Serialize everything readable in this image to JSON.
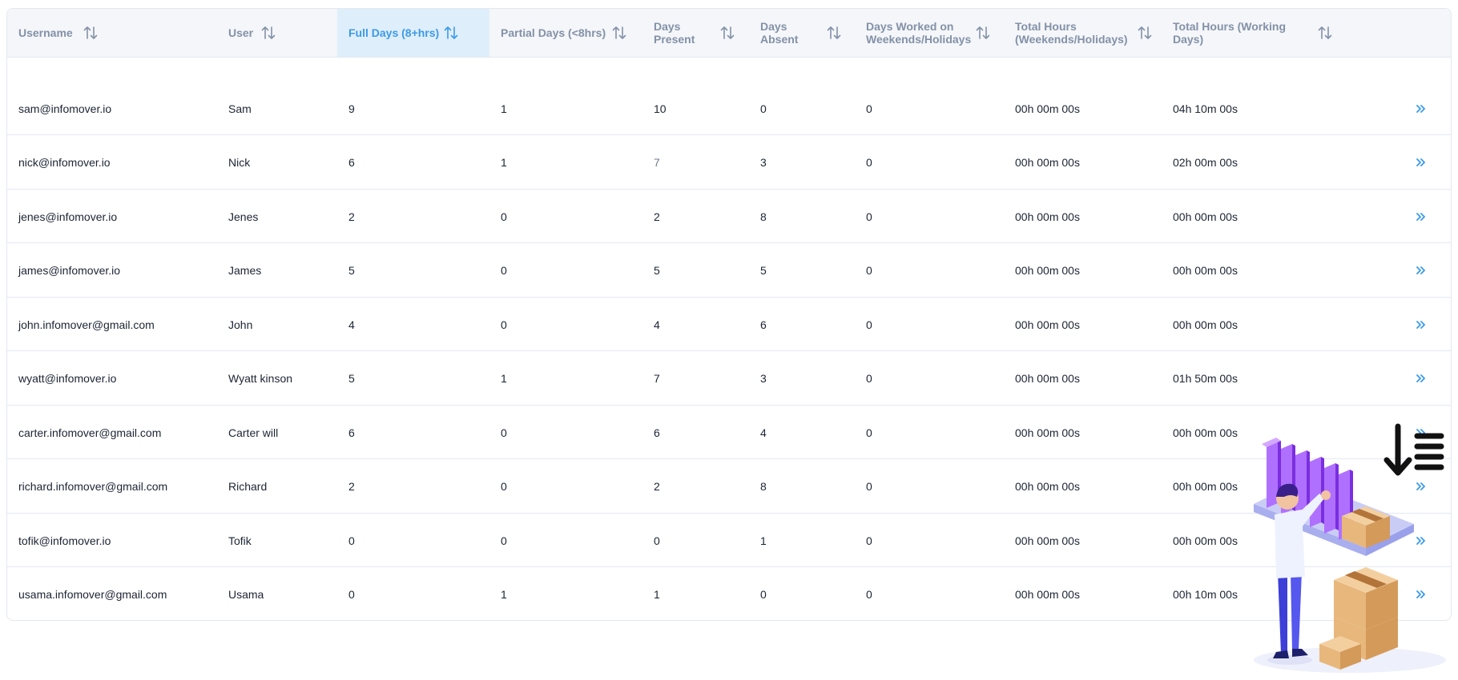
{
  "table": {
    "columns": [
      {
        "key": "username",
        "label": "Username",
        "sort_icon": "sort-arrows-icon",
        "active": false
      },
      {
        "key": "user",
        "label": "User",
        "sort_icon": "sort-arrows-icon",
        "active": false
      },
      {
        "key": "full_days",
        "label": "Full Days (8+hrs)",
        "sort_icon": "sort-arrows-icon",
        "active": true
      },
      {
        "key": "partial_days",
        "label": "Partial Days (<8hrs)",
        "sort_icon": "sort-arrows-icon",
        "active": false
      },
      {
        "key": "days_present",
        "label": "Days\nPresent",
        "sort_icon": "sort-arrows-icon",
        "active": false
      },
      {
        "key": "days_absent",
        "label": "Days\nAbsent",
        "sort_icon": "sort-arrows-icon",
        "active": false
      },
      {
        "key": "weekend_days",
        "label": "Days Worked on\nWeekends/Holidays",
        "sort_icon": "sort-arrows-icon",
        "active": false
      },
      {
        "key": "weekend_hours",
        "label": "Total Hours\n(Weekends/Holidays)",
        "sort_icon": "sort-arrows-icon",
        "active": false
      },
      {
        "key": "working_hours",
        "label": "Total Hours (Working\nDays)",
        "sort_icon": "sort-arrows-icon",
        "active": false
      }
    ],
    "rows": [
      {
        "username": "sam@infomover.io",
        "user": "Sam",
        "full_days": "9",
        "partial_days": "1",
        "days_present": "10",
        "days_absent": "0",
        "weekend_days": "0",
        "weekend_hours": "00h 00m 00s",
        "working_hours": "04h 10m 00s"
      },
      {
        "username": "nick@infomover.io",
        "user": "Nick",
        "full_days": "6",
        "partial_days": "1",
        "days_present": "7",
        "days_absent": "3",
        "weekend_days": "0",
        "weekend_hours": "00h 00m 00s",
        "working_hours": "02h 00m 00s"
      },
      {
        "username": "jenes@infomover.io",
        "user": "Jenes",
        "full_days": "2",
        "partial_days": "0",
        "days_present": "2",
        "days_absent": "8",
        "weekend_days": "0",
        "weekend_hours": "00h 00m 00s",
        "working_hours": "00h 00m 00s"
      },
      {
        "username": "james@infomover.io",
        "user": "James",
        "full_days": "5",
        "partial_days": "0",
        "days_present": "5",
        "days_absent": "5",
        "weekend_days": "0",
        "weekend_hours": "00h 00m 00s",
        "working_hours": "00h 00m 00s"
      },
      {
        "username": "john.infomover@gmail.com",
        "user": "John",
        "full_days": "4",
        "partial_days": "0",
        "days_present": "4",
        "days_absent": "6",
        "weekend_days": "0",
        "weekend_hours": "00h 00m 00s",
        "working_hours": "00h 00m 00s"
      },
      {
        "username": "wyatt@infomover.io",
        "user": "Wyatt kinson",
        "full_days": "5",
        "partial_days": "1",
        "days_present": "7",
        "days_absent": "3",
        "weekend_days": "0",
        "weekend_hours": "00h 00m 00s",
        "working_hours": "01h 50m 00s"
      },
      {
        "username": "carter.infomover@gmail.com",
        "user": "Carter will",
        "full_days": "6",
        "partial_days": "0",
        "days_present": "6",
        "days_absent": "4",
        "weekend_days": "0",
        "weekend_hours": "00h 00m 00s",
        "working_hours": "00h 00m 00s"
      },
      {
        "username": "richard.infomover@gmail.com",
        "user": "Richard",
        "full_days": "2",
        "partial_days": "0",
        "days_present": "2",
        "days_absent": "8",
        "weekend_days": "0",
        "weekend_hours": "00h 00m 00s",
        "working_hours": "00h 00m 00s"
      },
      {
        "username": "tofik@infomover.io",
        "user": "Tofik",
        "full_days": "0",
        "partial_days": "0",
        "days_present": "0",
        "days_absent": "1",
        "weekend_days": "0",
        "weekend_hours": "00h 00m 00s",
        "working_hours": "00h 00m 00s"
      },
      {
        "username": "usama.infomover@gmail.com",
        "user": "Usama",
        "full_days": "0",
        "partial_days": "1",
        "days_present": "1",
        "days_absent": "0",
        "weekend_days": "0",
        "weekend_hours": "00h 00m 00s",
        "working_hours": "00h 10m 00s"
      }
    ],
    "row_action_icon": "chevron-double-right-icon",
    "muted_cells": [
      {
        "row": 1,
        "key": "days_present"
      }
    ]
  },
  "overlay": {
    "sort_list_icon": "sort-descending-list-icon",
    "illustration": "warehouse-worker-illustration"
  },
  "colors": {
    "accent": "#3b9ae8",
    "header_bg": "#f4f6f9",
    "active_header_bg": "#dfeefb",
    "header_text": "#8391a7",
    "row_text": "#1c2433",
    "border": "#e3e8ef",
    "shelf_purple": "#8c3ff0",
    "box_tan": "#e8b77c"
  }
}
